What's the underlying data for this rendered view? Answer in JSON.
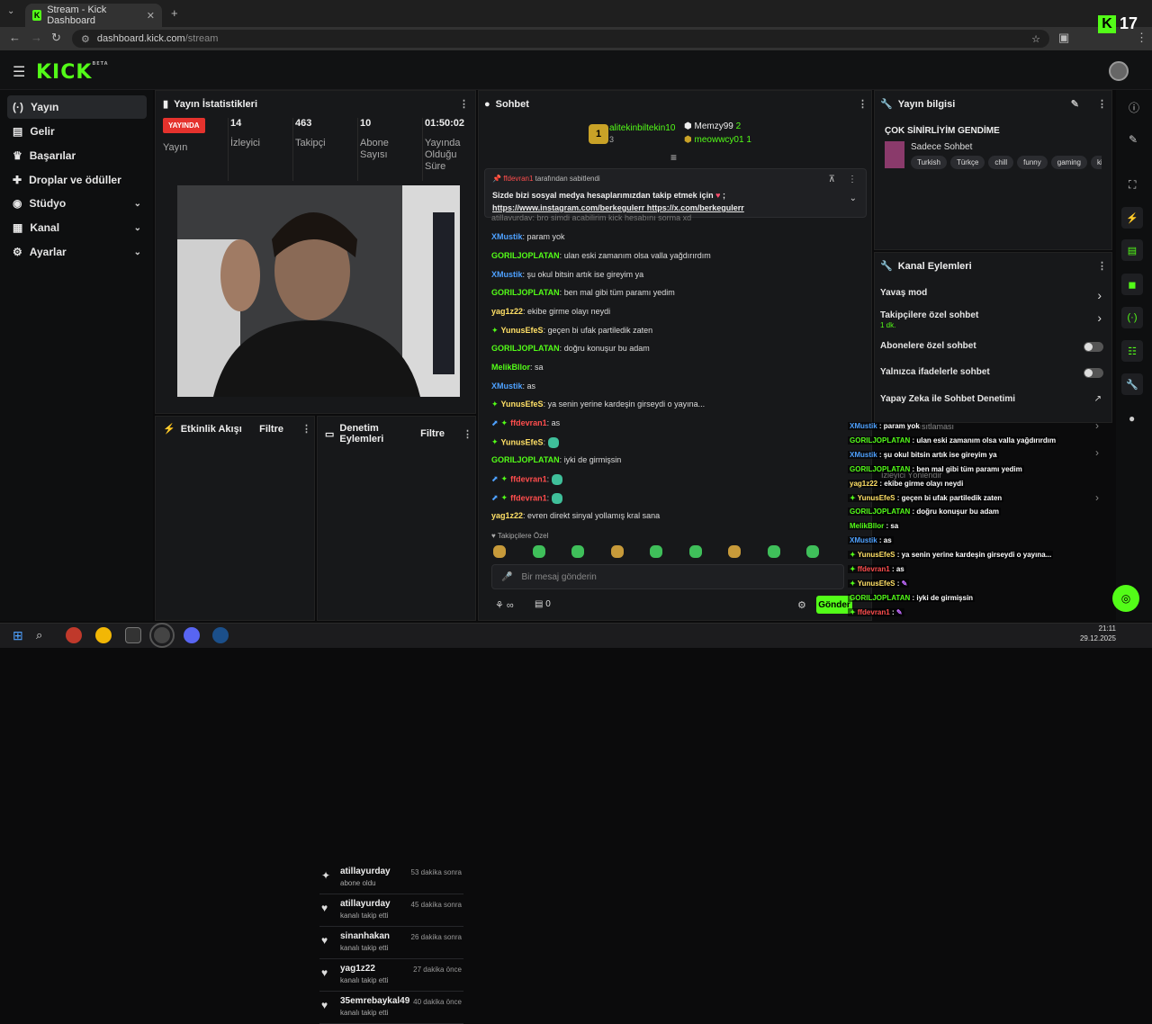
{
  "browser": {
    "tab_title": "Stream - Kick Dashboard",
    "url_host": "dashboard.kick.com",
    "url_path": "/stream",
    "badge_count": "17"
  },
  "app": {
    "logo": "KICK",
    "logo_sup": "BETA"
  },
  "sidebar": {
    "items": [
      {
        "label": "Yayın",
        "icon": "broadcast-icon"
      },
      {
        "label": "Gelir",
        "icon": "wallet-icon"
      },
      {
        "label": "Başarılar",
        "icon": "trophy-icon"
      },
      {
        "label": "Droplar ve ödüller",
        "icon": "gift-icon"
      },
      {
        "label": "Stüdyo",
        "icon": "camera-icon"
      },
      {
        "label": "Kanal",
        "icon": "channel-icon"
      },
      {
        "label": "Ayarlar",
        "icon": "gear-icon"
      }
    ]
  },
  "stats": {
    "title": "Yayın İstatistikleri",
    "live_badge": "YAYINDA",
    "live_label": "Yayın",
    "viewers_value": "14",
    "viewers_label": "İzleyici",
    "followers_value": "463",
    "followers_label": "Takipçi",
    "subs_value": "10",
    "subs_label": "Abone Sayısı",
    "duration_value": "01:50:02",
    "duration_label": "Yayında Olduğu Süre"
  },
  "activity": {
    "title": "Etkinlik Akışı",
    "filter": "Filtre",
    "items": [
      {
        "user": "atillayurday",
        "action": "abone oldu",
        "time": "53 dakika sonra"
      },
      {
        "user": "atillayurday",
        "action": "kanalı takip etti",
        "time": "45 dakika sonra"
      },
      {
        "user": "sinanhakan",
        "action": "kanalı takip etti",
        "time": "26 dakika sonra"
      },
      {
        "user": "yag1z22",
        "action": "kanalı takip etti",
        "time": "27 dakika önce"
      },
      {
        "user": "35emrebaykal49",
        "action": "kanalı takip etti",
        "time": "40 dakika önce"
      }
    ]
  },
  "moderation": {
    "title": "Denetim Eylemleri",
    "filter": "Filtre"
  },
  "chat": {
    "title": "Sohbet",
    "top_gifters": [
      {
        "name": "alitekinbiltekin10",
        "count": "3"
      },
      {
        "name": "Memzy99",
        "count": "2"
      },
      {
        "name": "meowwcy01",
        "count": "1"
      }
    ],
    "pinned_by": "ffdevran1",
    "pinned_by_suffix": "tarafından sabitlendi",
    "pinned_text": "Sizde bizi sosyal medya hesaplarımızdan takip etmek için",
    "pinned_link1": "https://www.instagram.com/berkegulerr",
    "pinned_link2": "https://x.com/berkegulerr",
    "partial_line": "atillayurday: bro şimdi açabilirim kick hesabını sorma xd",
    "messages": [
      {
        "user": "XMustik",
        "color": "b",
        "text": "param yok"
      },
      {
        "user": "GORILJOPLATAN",
        "color": "g",
        "text": "ulan eski zamanım olsa valla yağdırırdım"
      },
      {
        "user": "XMustik",
        "color": "b",
        "text": "şu okul bitsin artık ise gireyim ya"
      },
      {
        "user": "GORILJOPLATAN",
        "color": "g",
        "text": "ben mal gibi tüm paramı yedim"
      },
      {
        "user": "yag1z22",
        "color": "y",
        "text": "ekibe girme olayı neydi"
      },
      {
        "user": "YunusEfeS",
        "color": "y",
        "text": "geçen bi ufak partiledik zaten"
      },
      {
        "user": "GORILJOPLATAN",
        "color": "g",
        "text": "doğru konuşur bu adam"
      },
      {
        "user": "MelikBllor",
        "color": "g",
        "text": "sa"
      },
      {
        "user": "XMustik",
        "color": "b",
        "text": "as"
      },
      {
        "user": "YunusEfeS",
        "color": "y",
        "text": "ya senin yerine kardeşin girseydi o yayına..."
      },
      {
        "user": "ffdevran1",
        "color": "r",
        "text": "as"
      },
      {
        "user": "YunusEfeS",
        "color": "y",
        "text": ""
      },
      {
        "user": "GORILJOPLATAN",
        "color": "g",
        "text": "iyki de girmişsin"
      },
      {
        "user": "ffdevran1",
        "color": "r",
        "text": ""
      },
      {
        "user": "ffdevran1",
        "color": "r",
        "text": ""
      },
      {
        "user": "yag1z22",
        "color": "y",
        "text": "evren direkt sinyal yollamış kral sana"
      }
    ],
    "followers_only_label": "Takipçilere Özel",
    "input_placeholder": "Bir mesaj gönderin",
    "points": "0",
    "send_label": "Gönder"
  },
  "stream_info": {
    "title": "Yayın bilgisi",
    "stream_title": "ÇOK SİNİRLİYİM GENDİME",
    "category": "Sadece Sohbet",
    "tags": [
      "Turkish",
      "Türkçe",
      "chill",
      "funny",
      "gaming",
      "ki"
    ]
  },
  "channel_actions": {
    "title": "Kanal Eylemleri",
    "items": [
      {
        "label": "Yavaş mod",
        "sub": "",
        "control": "arrow"
      },
      {
        "label": "Takipçilere özel sohbet",
        "sub": "1 dk.",
        "control": "arrow"
      },
      {
        "label": "Abonelere özel sohbet",
        "sub": "",
        "control": "toggle"
      },
      {
        "label": "Yalnızca ifadelerle sohbet",
        "sub": "",
        "control": "toggle"
      },
      {
        "label": "Yapay Zeka ile Sohbet Denetimi",
        "sub": "",
        "control": "external"
      }
    ],
    "hidden_1": "...kı kısıtlaması",
    "hidden_2": "İzleyici Yönlendir"
  },
  "overlay_chat": [
    {
      "user": "XMustik",
      "color": "b",
      "text": "param yok"
    },
    {
      "user": "GORILJOPLATAN",
      "color": "g",
      "text": "ulan eski zamanım olsa valla yağdırırdım"
    },
    {
      "user": "XMustik",
      "color": "b",
      "text": "şu okul bitsin artık ise gireyim ya"
    },
    {
      "user": "GORILJOPLATAN",
      "color": "g",
      "text": "ben mal gibi tüm paramı yedim"
    },
    {
      "user": "yag1z22",
      "color": "y",
      "text": "ekibe girme olayı neydi"
    },
    {
      "user": "YunusEfeS",
      "color": "y",
      "text": "geçen bi ufak partiledik zaten"
    },
    {
      "user": "GORILJOPLATAN",
      "color": "g",
      "text": "doğru konuşur bu adam"
    },
    {
      "user": "MelikBllor",
      "color": "g",
      "text": "sa"
    },
    {
      "user": "XMustik",
      "color": "b",
      "text": "as"
    },
    {
      "user": "YunusEfeS",
      "color": "y",
      "text": "ya senin yerine kardeşin girseydi o yayına..."
    },
    {
      "user": "ffdevran1",
      "color": "r",
      "text": "as"
    },
    {
      "user": "YunusEfeS",
      "color": "y",
      "text": ""
    },
    {
      "user": "GORILJOPLATAN",
      "color": "g",
      "text": "iyki de girmişsin"
    },
    {
      "user": "ffdevran1",
      "color": "r",
      "text": ""
    },
    {
      "user": "ffdevran1",
      "color": "r",
      "text": ""
    },
    {
      "user": "yag1z22",
      "color": "y",
      "text": "evren direkt sinyal yollamış kral sana"
    }
  ],
  "taskbar": {
    "time": "21:11",
    "date": "29.12.2025"
  },
  "colors": {
    "accent": "#53fc18",
    "live": "#e5322d"
  }
}
